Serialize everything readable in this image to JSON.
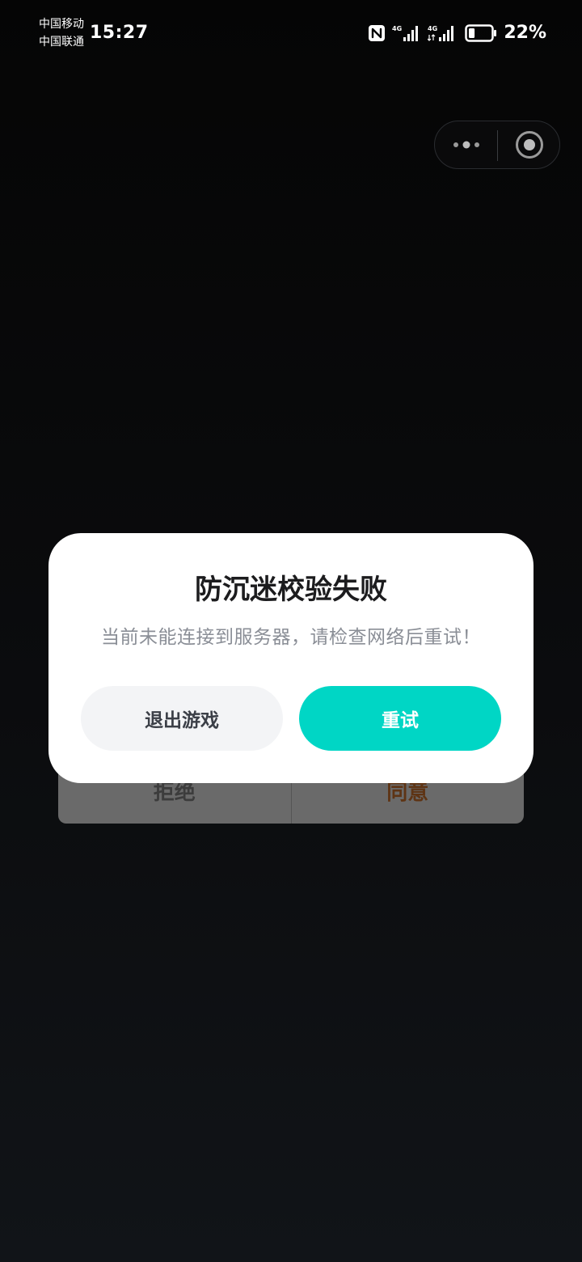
{
  "status_bar": {
    "carrier_1": "中国移动",
    "carrier_2": "中国联通",
    "time": "15:27",
    "network_1": "4G",
    "network_2": "4G",
    "battery_percent": "22%",
    "battery_level": 0.22,
    "icons": [
      "nfc-icon",
      "signal-4g-icon",
      "signal-4g-icon",
      "battery-icon"
    ]
  },
  "capsule": {
    "icons": [
      "more-dots-icon",
      "close-circle-icon"
    ]
  },
  "underlay": {
    "reject_label": "拒绝",
    "agree_label": "同意",
    "agree_color": "#5e3414"
  },
  "dialog": {
    "title": "防沉迷校验失败",
    "message": "当前未能连接到服务器，请检查网络后重试！",
    "exit_label": "退出游戏",
    "retry_label": "重试",
    "retry_color": "#00d6c5"
  }
}
